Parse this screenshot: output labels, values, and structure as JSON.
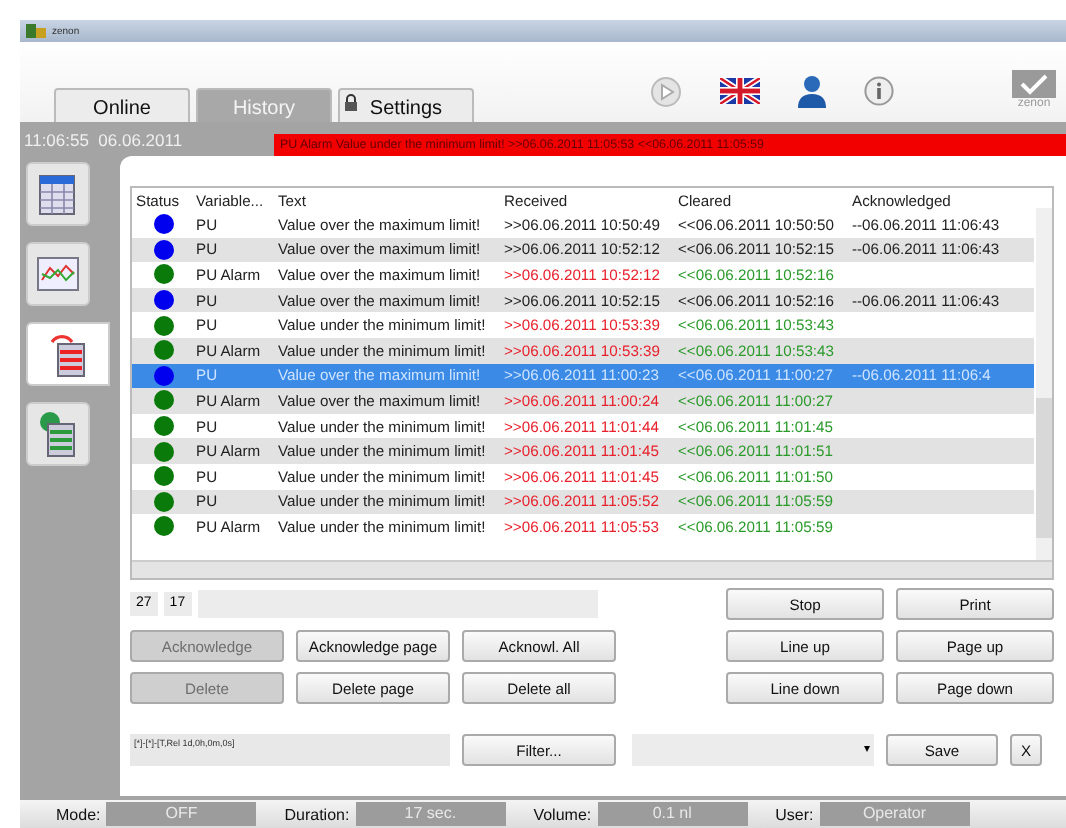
{
  "window": {
    "title": "zenon"
  },
  "tabs": [
    {
      "label": "Online",
      "selected": false,
      "kind": "plain"
    },
    {
      "label": "History",
      "selected": true,
      "kind": "plain"
    },
    {
      "label": "Settings",
      "selected": false,
      "kind": "locked"
    }
  ],
  "logo": {
    "text": "zenon"
  },
  "clock": "11:06:55  06.06.2011",
  "alert": "PU Alarm Value under the minimum limit! >>06.06.2011 11:05:53 <<06.06.2011 11:05:59",
  "sidebar": {
    "items": [
      {
        "kind": "table",
        "selected": false
      },
      {
        "kind": "chart",
        "selected": false
      },
      {
        "kind": "alarms",
        "selected": true
      },
      {
        "kind": "events",
        "selected": false
      }
    ]
  },
  "table": {
    "columns": [
      "Status",
      "Variable...",
      "Text",
      "Received",
      "Cleared",
      "Acknowledged"
    ],
    "rows": [
      {
        "color": "#0000ee",
        "kind": "acknowledged",
        "selected": false,
        "variable": "PU",
        "text": "Value over the maximum limit!",
        "received": ">>06.06.2011 10:50:49",
        "cleared": "<<06.06.2011 10:50:50",
        "acknowledged": "--06.06.2011 11:06:43"
      },
      {
        "color": "#0000ee",
        "kind": "acknowledged",
        "selected": false,
        "variable": "PU",
        "text": "Value over the maximum limit!",
        "received": ">>06.06.2011 10:52:12",
        "cleared": "<<06.06.2011 10:52:15",
        "acknowledged": "--06.06.2011 11:06:43"
      },
      {
        "color": "#0a7a0a",
        "kind": "open",
        "selected": false,
        "variable": "PU Alarm",
        "text": "Value over the maximum limit!",
        "received": ">>06.06.2011 10:52:12",
        "cleared": "<<06.06.2011 10:52:16"
      },
      {
        "color": "#0000ee",
        "kind": "acknowledged",
        "selected": false,
        "variable": "PU",
        "text": "Value over the maximum limit!",
        "received": ">>06.06.2011 10:52:15",
        "cleared": "<<06.06.2011 10:52:16",
        "acknowledged": "--06.06.2011 11:06:43"
      },
      {
        "color": "#0a7a0a",
        "kind": "open",
        "selected": false,
        "variable": "PU",
        "text": "Value under the minimum limit!",
        "received": ">>06.06.2011 10:53:39",
        "cleared": "<<06.06.2011 10:53:43"
      },
      {
        "color": "#0a7a0a",
        "kind": "open",
        "selected": false,
        "variable": "PU Alarm",
        "text": "Value under the minimum limit!",
        "received": ">>06.06.2011 10:53:39",
        "cleared": "<<06.06.2011 10:53:43"
      },
      {
        "color": "#0000ee",
        "kind": "acknowledged",
        "selected": true,
        "variable": "PU",
        "text": "Value over the maximum limit!",
        "received": ">>06.06.2011 11:00:23",
        "cleared": "<<06.06.2011 11:00:27",
        "acknowledged": "--06.06.2011 11:06:4"
      },
      {
        "color": "#0a7a0a",
        "kind": "open",
        "selected": false,
        "variable": "PU Alarm",
        "text": "Value over the maximum limit!",
        "received": ">>06.06.2011 11:00:24",
        "cleared": "<<06.06.2011 11:00:27"
      },
      {
        "color": "#0a7a0a",
        "kind": "open",
        "selected": false,
        "variable": "PU",
        "text": "Value under the minimum limit!",
        "received": ">>06.06.2011 11:01:44",
        "cleared": "<<06.06.2011 11:01:45"
      },
      {
        "color": "#0a7a0a",
        "kind": "open",
        "selected": false,
        "variable": "PU Alarm",
        "text": "Value under the minimum limit!",
        "received": ">>06.06.2011 11:01:45",
        "cleared": "<<06.06.2011 11:01:51"
      },
      {
        "color": "#0a7a0a",
        "kind": "open",
        "selected": false,
        "variable": "PU",
        "text": "Value under the minimum limit!",
        "received": ">>06.06.2011 11:01:45",
        "cleared": "<<06.06.2011 11:01:50"
      },
      {
        "color": "#0a7a0a",
        "kind": "open",
        "selected": false,
        "variable": "PU",
        "text": "Value under the minimum limit!",
        "received": ">>06.06.2011 11:05:52",
        "cleared": "<<06.06.2011 11:05:59"
      },
      {
        "color": "#0a7a0a",
        "kind": "open",
        "selected": false,
        "variable": "PU Alarm",
        "text": "Value under the minimum limit!",
        "received": ">>06.06.2011 11:05:53",
        "cleared": "<<06.06.2011 11:05:59"
      }
    ]
  },
  "counters": [
    "27",
    "17"
  ],
  "buttons_left": [
    {
      "label": "Acknowledge",
      "disabled": true
    },
    {
      "label": "Acknowledge page",
      "disabled": false
    },
    {
      "label": "Acknowl. All",
      "disabled": false
    },
    {
      "label": "Delete",
      "disabled": true
    },
    {
      "label": "Delete page",
      "disabled": false
    },
    {
      "label": "Delete all",
      "disabled": false
    }
  ],
  "buttons_right": [
    {
      "label": "Stop"
    },
    {
      "label": "Print"
    },
    {
      "label": "Line up"
    },
    {
      "label": "Page up"
    },
    {
      "label": "Line down"
    },
    {
      "label": "Page down"
    }
  ],
  "filter": {
    "value": "[*]-[*]-[T,Rel 1d,0h,0m,0s]",
    "button": "Filter..."
  },
  "save": {
    "caret": "▾",
    "button": "Save",
    "close": "X"
  },
  "status_bar": [
    {
      "label": "Mode:",
      "value": "OFF"
    },
    {
      "label": "Duration:",
      "value": "17 sec."
    },
    {
      "label": "Volume:",
      "value": "0.1 nl"
    },
    {
      "label": "User:",
      "value": "Operator"
    }
  ]
}
